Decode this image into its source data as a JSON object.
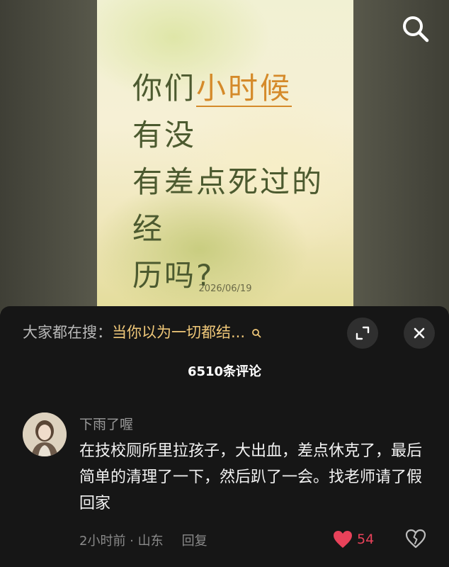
{
  "video": {
    "title_line1_pre": "你们",
    "title_highlight": "小时候",
    "title_line1_post": "有没",
    "title_line2": "有差点死过的经",
    "title_line3": "历吗?",
    "date": "2026/06/19",
    "search_icon": "search-icon"
  },
  "comments_panel": {
    "search_prefix": "大家都在搜：",
    "search_query": "当你以为一切都结...",
    "expand_icon": "expand-icon",
    "close_icon": "close-icon",
    "comment_count": "6510条评论",
    "comments": [
      {
        "author": "下雨了喔",
        "text": "在技校厕所里拉孩子，大出血，差点休克了，最后简单的清理了一下，然后趴了一会。找老师请了假回家",
        "time_location": "2小时前 · 山东",
        "reply_label": "回复",
        "likes": "54",
        "like_color": "#e8425a"
      }
    ]
  }
}
